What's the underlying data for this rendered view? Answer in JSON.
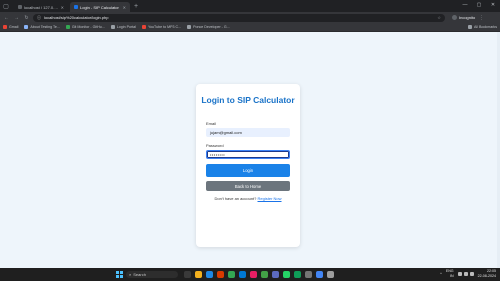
{
  "browser": {
    "tabs": [
      {
        "title": "localhost / 127.0.0.1 / sip_calc",
        "active": false
      },
      {
        "title": "Login - SIP Calculator",
        "active": true
      }
    ],
    "new_tab": "+",
    "address": "localhost/sip%20calculator/login.php",
    "profile": "Incognito",
    "bookmarks": [
      "Gmail",
      "About Testing Te...",
      "Git Monitor - GitHu...",
      "Login Portal",
      "YouTube to MP3 C...",
      "Ponce Developer - G..."
    ],
    "all_bookmarks": "All Bookmarks"
  },
  "page": {
    "title": "Login to SIP Calculator",
    "email_label": "Email",
    "email_value": "jujam@gmail.com",
    "password_label": "Password",
    "password_value": "••••••••",
    "login_button": "Login",
    "home_button": "Back to Home",
    "signup_prompt": "Don't have an account?",
    "signup_link": "Register Now"
  },
  "taskbar": {
    "search_placeholder": "Search",
    "lang": "ENG",
    "region": "IN",
    "time": "22:05",
    "date": "22-08-2024"
  },
  "colors": {
    "accent": "#1a82e8",
    "title": "#1a73c8",
    "secondary_button": "#6c757d",
    "page_bg": "#eef5fb"
  }
}
